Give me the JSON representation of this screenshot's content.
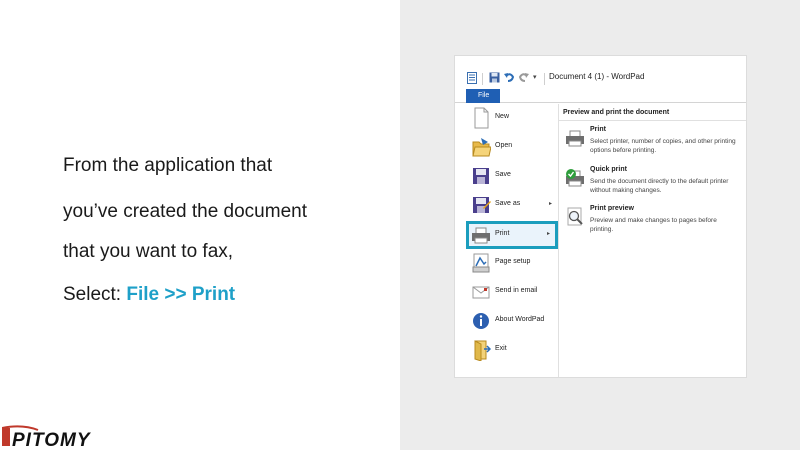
{
  "slide": {
    "line1": "From the application that",
    "line2": "you’ve created the document",
    "line3": "that you want to fax,",
    "line4_prefix": "Select: ",
    "line4_accent": "File >> Print",
    "accent_color": "#1ea0c8",
    "logo_text": "IPitomy"
  },
  "window": {
    "title": "Document 4 (1) - WordPad",
    "quick_access_icons": [
      "wordpad-app-icon",
      "save-icon",
      "undo-icon",
      "redo-icon",
      "customize-dropdown-icon"
    ],
    "file_tab_label": "File"
  },
  "file_menu": {
    "items": [
      {
        "label": "New",
        "icon": "new-document-icon"
      },
      {
        "label": "Open",
        "icon": "open-folder-icon"
      },
      {
        "label": "Save",
        "icon": "save-icon"
      },
      {
        "label": "Save as",
        "icon": "save-as-icon",
        "has_submenu": true
      },
      {
        "label": "Print",
        "icon": "printer-icon",
        "has_submenu": true,
        "highlighted": true
      },
      {
        "label": "Page setup",
        "icon": "page-setup-icon"
      },
      {
        "label": "Send in email",
        "icon": "email-icon"
      },
      {
        "label": "About WordPad",
        "icon": "info-icon"
      },
      {
        "label": "Exit",
        "icon": "exit-icon"
      }
    ],
    "submenu_arrow": "▸"
  },
  "print_submenu": {
    "heading": "Preview and print the document",
    "options": [
      {
        "title": "Print",
        "desc": "Select printer, number of copies, and other printing options before printing.",
        "icon": "printer-icon"
      },
      {
        "title": "Quick print",
        "desc": "Send the document directly to the default printer without making changes.",
        "icon": "quick-print-icon"
      },
      {
        "title": "Print preview",
        "desc": "Preview and make changes to pages before printing.",
        "icon": "magnifier-icon"
      }
    ]
  },
  "colors": {
    "highlight_border": "#1b9dbd",
    "file_tab": "#1f5fb4",
    "right_panel_bg": "#ececec"
  }
}
